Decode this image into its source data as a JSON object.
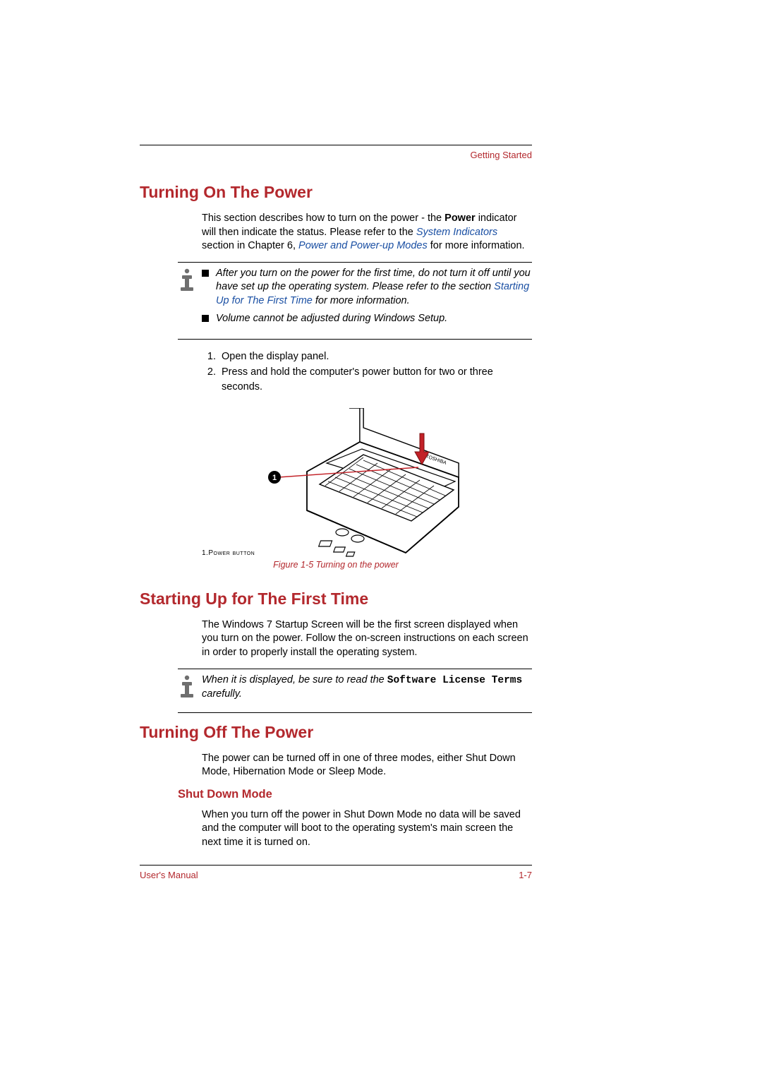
{
  "header": {
    "section_label": "Getting Started"
  },
  "s1": {
    "heading": "Turning On The Power",
    "intro_a": "This section describes how to turn on the power - the ",
    "intro_bold": "Power",
    "intro_b": " indicator will then indicate the status. Please refer to the ",
    "intro_link1": "System Indicators",
    "intro_c": " section in Chapter 6, ",
    "intro_link2": "Power and Power-up Modes",
    "intro_d": " for more information.",
    "note_b1_a": "After you turn on the power for the first time, do not turn it off until you have set up the operating system. Please refer to the section ",
    "note_b1_link": "Starting Up for The First Time",
    "note_b1_b": " for more information.",
    "note_b2": "Volume cannot be adjusted during Windows Setup.",
    "step1": "Open the display panel.",
    "step2": "Press and hold the computer's power button for two or three seconds.",
    "fig_legend_num": "1.",
    "fig_legend_label": "Power button",
    "fig_caption": "Figure 1-5 Turning on the power",
    "fig_brand": "TOSHIBA"
  },
  "s2": {
    "heading": "Starting Up for The First Time",
    "para": "The Windows 7 Startup Screen will be the first screen displayed when you turn on the power. Follow the on-screen instructions on each screen in order to properly install the operating system.",
    "note_a": "When it is displayed, be sure to read the ",
    "note_mono": "Software License Terms",
    "note_b": " carefully."
  },
  "s3": {
    "heading": "Turning Off The Power",
    "para": "The power can be turned off in one of three modes, either Shut Down Mode, Hibernation Mode or Sleep Mode.",
    "sub_heading": "Shut Down Mode",
    "sub_para": "When you turn off the power in Shut Down Mode no data will be saved and the computer will boot to the operating system's main screen the next time it is turned on."
  },
  "footer": {
    "left": "User's Manual",
    "right": "1-7"
  }
}
